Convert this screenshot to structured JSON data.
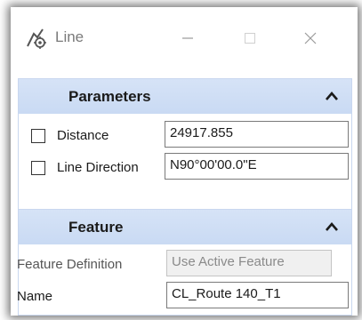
{
  "window": {
    "title": "Line",
    "icon": "line-tool-icon",
    "buttons": [
      "minimize-icon",
      "maximize-icon",
      "close-icon"
    ]
  },
  "parameters": {
    "header": "Parameters",
    "distance": {
      "label": "Distance",
      "value": "24917.855",
      "checked": false
    },
    "line_direction": {
      "label": "Line Direction",
      "value": "N90°00'00.0\"E",
      "checked": false
    }
  },
  "feature": {
    "header": "Feature",
    "feature_definition": {
      "label": "Feature Definition",
      "value": "Use Active Feature"
    },
    "name": {
      "label": "Name",
      "value": "CL_Route 140_T1"
    }
  },
  "colors": {
    "header_bg": "#cfdef4",
    "border": "#c9d7ef",
    "text": "#1a1a1a",
    "title_text": "#7a7a7a"
  }
}
